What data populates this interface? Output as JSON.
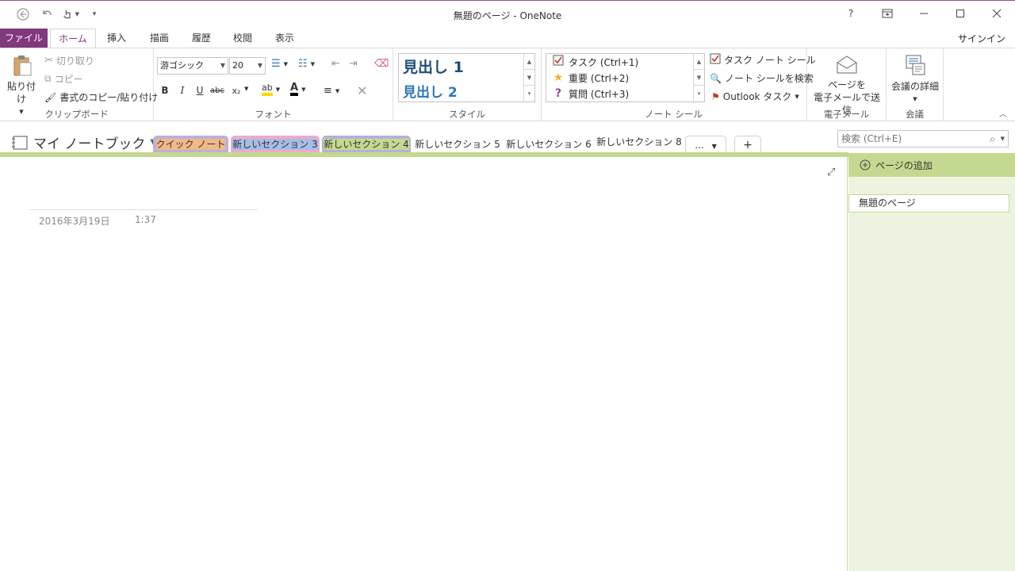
{
  "window": {
    "title": "無題のページ - OneNote",
    "help": "?"
  },
  "ribbon_tabs": [
    "ファイル",
    "ホーム",
    "挿入",
    "描画",
    "履歴",
    "校閲",
    "表示"
  ],
  "signin": "サインイン",
  "clipboard": {
    "paste": "貼り付け",
    "cut": "切り取り",
    "copy": "コピー",
    "format_painter": "書式のコピー/貼り付け",
    "label": "クリップボード"
  },
  "font": {
    "name": "游ゴシック",
    "size": "20",
    "label": "フォント",
    "bold": "B",
    "italic": "I",
    "underline": "U",
    "strike": "abc",
    "subscript": "x₂"
  },
  "styles": {
    "heading1": "見出し 1",
    "heading2": "見出し 2",
    "label": "スタイル"
  },
  "tags": {
    "items": [
      {
        "label": "タスク (Ctrl+1)",
        "icon": "checkbox-icon"
      },
      {
        "label": "重要 (Ctrl+2)",
        "icon": "star-icon"
      },
      {
        "label": "質問 (Ctrl+3)",
        "icon": "question-icon"
      }
    ],
    "todo_tag": "タスク ノート シール",
    "find_tags": "ノート シールを検索",
    "outlook_tasks": "Outlook タスク",
    "label": "ノート シール"
  },
  "email": {
    "button_line1": "ページを",
    "button_line2": "電子メールで送信",
    "label": "電子メール"
  },
  "meetings": {
    "button": "会議の詳細",
    "label": "会議"
  },
  "notebook": {
    "name": "マイ ノートブック",
    "sections": [
      {
        "label": "クイック ノート",
        "color": "#b8b2dc"
      },
      {
        "label": "新しいセクション 3",
        "color": "#f2b887"
      },
      {
        "label": "新しいセクション 4",
        "color": "#eeaacd"
      },
      {
        "label": "新しいセクション 5",
        "color": "#a8bde6"
      },
      {
        "label": "新しいセクション 6",
        "color": "#b6b0dc"
      },
      {
        "label": "新しいセクション 8",
        "color": "#c4d98f"
      }
    ],
    "more": "...",
    "add": "+"
  },
  "search": {
    "placeholder": "検索 (Ctrl+E)"
  },
  "page": {
    "date": "2016年3月19日",
    "time": "1:37"
  },
  "pages_pane": {
    "add_page": "ページの追加",
    "pages": [
      "無題のページ"
    ]
  }
}
